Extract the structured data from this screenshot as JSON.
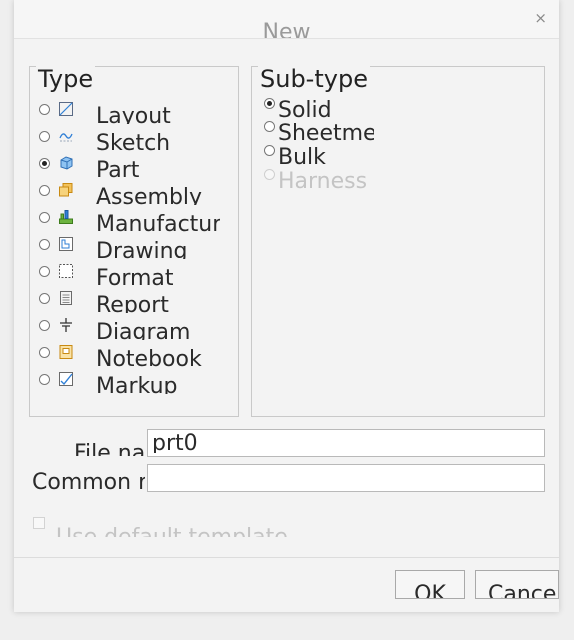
{
  "window": {
    "title": "New",
    "close_glyph": "×"
  },
  "type_group": {
    "legend": "Type",
    "options": [
      {
        "label": "Layout",
        "icon": "layout-icon",
        "selected": false
      },
      {
        "label": "Sketch",
        "icon": "sketch-icon",
        "selected": false
      },
      {
        "label": "Part",
        "icon": "part-icon",
        "selected": true
      },
      {
        "label": "Assembly",
        "icon": "assembly-icon",
        "selected": false
      },
      {
        "label": "Manufacturing",
        "icon": "manufacturing-icon",
        "selected": false
      },
      {
        "label": "Drawing",
        "icon": "drawing-icon",
        "selected": false
      },
      {
        "label": "Format",
        "icon": "format-icon",
        "selected": false
      },
      {
        "label": "Report",
        "icon": "report-icon",
        "selected": false
      },
      {
        "label": "Diagram",
        "icon": "diagram-icon",
        "selected": false
      },
      {
        "label": "Notebook",
        "icon": "notebook-icon",
        "selected": false
      },
      {
        "label": "Markup",
        "icon": "markup-icon",
        "selected": false
      }
    ]
  },
  "subtype_group": {
    "legend": "Sub-type",
    "options": [
      {
        "label": "Solid",
        "selected": true,
        "disabled": false
      },
      {
        "label": "Sheetmetal",
        "selected": false,
        "disabled": false
      },
      {
        "label": "Bulk",
        "selected": false,
        "disabled": false
      },
      {
        "label": "Harness",
        "selected": false,
        "disabled": true
      }
    ]
  },
  "file_name": {
    "label": "File name",
    "value": "prt0"
  },
  "common_name": {
    "label": "Common name",
    "value": ""
  },
  "default_template": {
    "label": "Use default template",
    "checked": false,
    "disabled": true
  },
  "buttons": {
    "ok": "OK",
    "cancel": "Cancel"
  },
  "colors": {
    "accent_orange": "#e8a019",
    "accent_blue": "#2f7fd6"
  }
}
